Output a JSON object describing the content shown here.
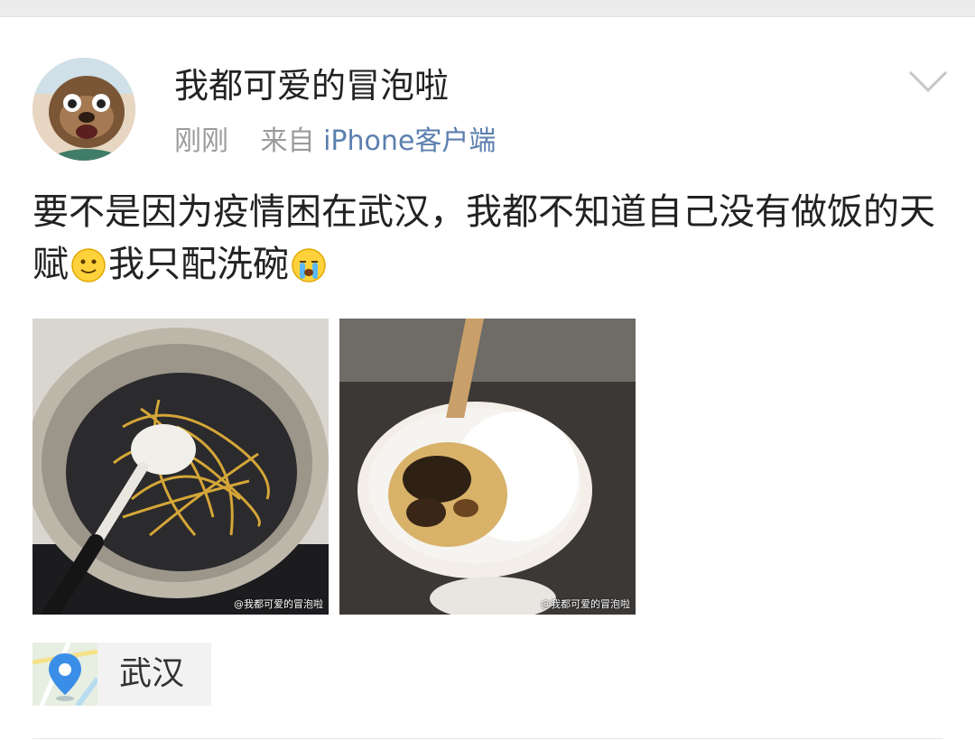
{
  "post": {
    "username": "我都可爱的冒泡啦",
    "time": "刚刚",
    "source_prefix": "来自",
    "source_client": "iPhone客户端",
    "text_part1": "要不是因为疫情困在武汉，我都不知道自己没有做饭的天赋",
    "text_part2": "我只配洗碗",
    "emoji_1": "smile-emoji",
    "emoji_2": "crying-emoji",
    "photos": [
      {
        "name": "burnt-noodles-photo",
        "watermark": "@我都可爱的冒泡啦"
      },
      {
        "name": "burnt-rice-photo",
        "watermark": "@我都可爱的冒泡啦"
      }
    ],
    "location": "武汉"
  },
  "icons": {
    "menu": "chevron-down-icon",
    "location": "location-pin-icon"
  },
  "colors": {
    "link": "#5b7fae",
    "meta": "#9a9a9a",
    "pin": "#3b8ee8"
  }
}
